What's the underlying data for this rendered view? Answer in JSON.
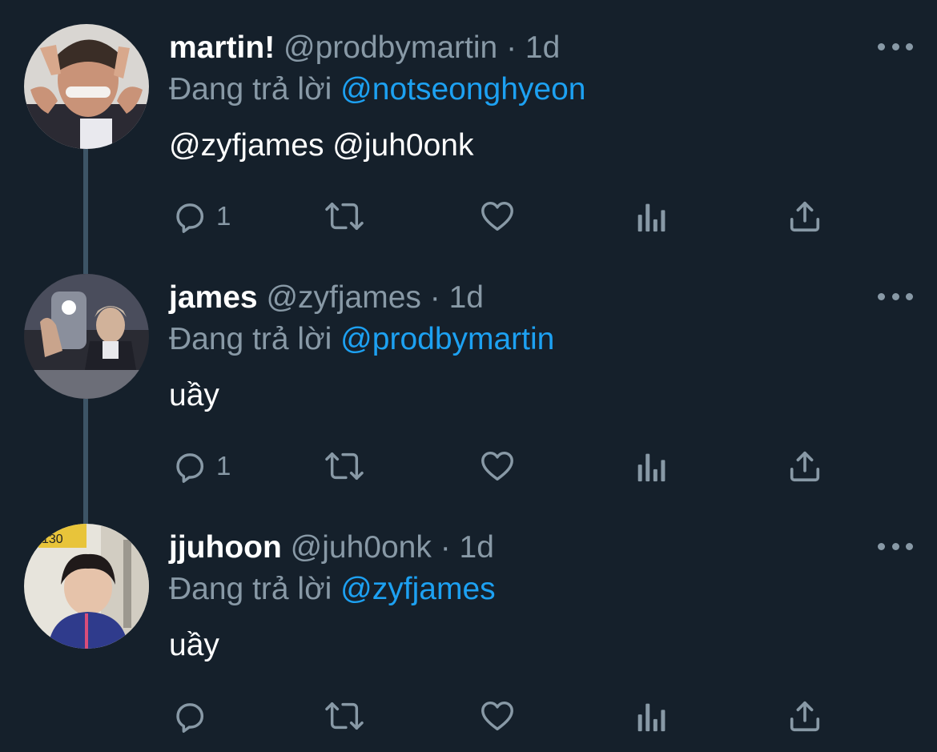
{
  "tweets": [
    {
      "display_name": "martin!",
      "handle": "@prodbymartin",
      "separator": "·",
      "time": "1d",
      "replying_label": "Đang trả lời",
      "replying_to": "@notseonghyeon",
      "body": "@zyfjames @juh0onk",
      "reply_count": "1"
    },
    {
      "display_name": "james",
      "handle": "@zyfjames",
      "separator": "·",
      "time": "1d",
      "replying_label": "Đang trả lời",
      "replying_to": "@prodbymartin",
      "body": "uầy",
      "reply_count": "1"
    },
    {
      "display_name": "jjuhoon",
      "handle": "@juh0onk",
      "separator": "·",
      "time": "1d",
      "replying_label": "Đang trả lời",
      "replying_to": "@zyfjames",
      "body": "uầy",
      "reply_count": ""
    }
  ],
  "avatar_badge": "130",
  "icons": [
    "reply-icon",
    "retweet-icon",
    "like-icon",
    "analytics-icon",
    "share-icon",
    "more-icon"
  ],
  "colors": {
    "background": "#15202b",
    "mention": "#1da1f2",
    "secondary_text": "#8899a6",
    "primary_text": "#ffffff",
    "thread_line": "#3d5466"
  }
}
